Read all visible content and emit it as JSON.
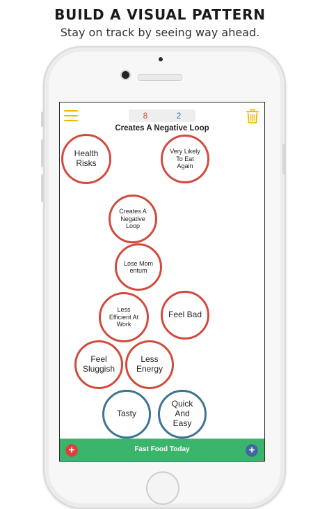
{
  "header": {
    "headline": "BUILD A VISUAL PATTERN",
    "subline": "Stay on track by seeing way ahead."
  },
  "app": {
    "score_bad": "8",
    "score_good": "2",
    "title": "Creates A Negative Loop",
    "icons": {
      "menu": "hamburger-menu-icon",
      "trash": "trash-icon"
    },
    "colors": {
      "accent": "#f2b705",
      "negative": "#d24a3e",
      "positive": "#3f7393",
      "bar": "#3bb56c"
    }
  },
  "bubbles": [
    {
      "label": "Health Risks",
      "type": "negative"
    },
    {
      "label": "Very Likely To Eat Again",
      "type": "negative"
    },
    {
      "label": "Creates A Negative Loop",
      "type": "negative"
    },
    {
      "label": "Lose Momentum",
      "type": "negative"
    },
    {
      "label": "Less Efficient At Work",
      "type": "negative"
    },
    {
      "label": "Feel Bad",
      "type": "negative"
    },
    {
      "label": "Feel Sluggish",
      "type": "negative"
    },
    {
      "label": "Less Energy",
      "type": "negative"
    },
    {
      "label": "Tasty",
      "type": "positive"
    },
    {
      "label": "Quick And Easy",
      "type": "positive"
    }
  ],
  "bottom_bar": {
    "label": "Fast Food Today",
    "add_negative": "+",
    "add_positive": "+"
  }
}
